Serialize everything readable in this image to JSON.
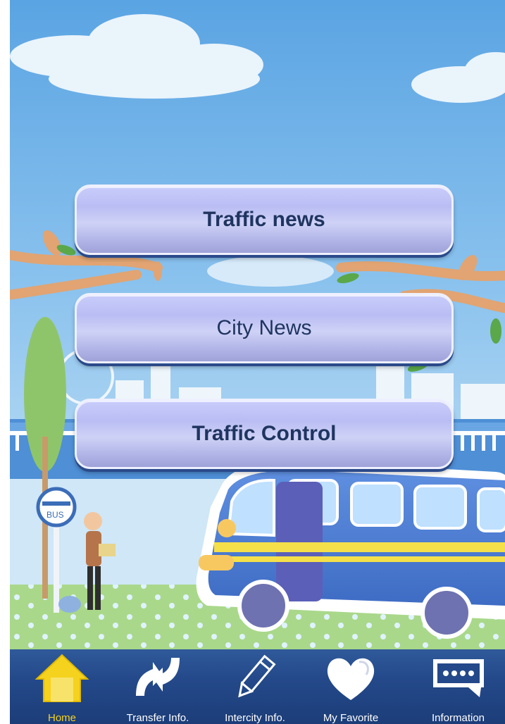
{
  "menu": {
    "items": [
      {
        "label": "Traffic news"
      },
      {
        "label": "City News"
      },
      {
        "label": "Traffic Control"
      }
    ]
  },
  "scene": {
    "bus_stop_sign": "BUS"
  },
  "tabbar": {
    "active": "Home",
    "tabs": [
      {
        "label": "Home",
        "icon": "home-icon"
      },
      {
        "label": "Transfer Info.",
        "icon": "transfer-arrows-icon"
      },
      {
        "label": "Intercity Info.",
        "icon": "pencil-icon"
      },
      {
        "label": "My Favorite",
        "icon": "heart-icon"
      },
      {
        "label": "Information",
        "icon": "speech-bubble-icon"
      }
    ]
  },
  "colors": {
    "sky_top": "#5aa4e3",
    "sky_bottom": "#cfe6f7",
    "button_text": "#1f3560",
    "tabbar": "#24498a",
    "tab_active": "#f5d21e"
  }
}
